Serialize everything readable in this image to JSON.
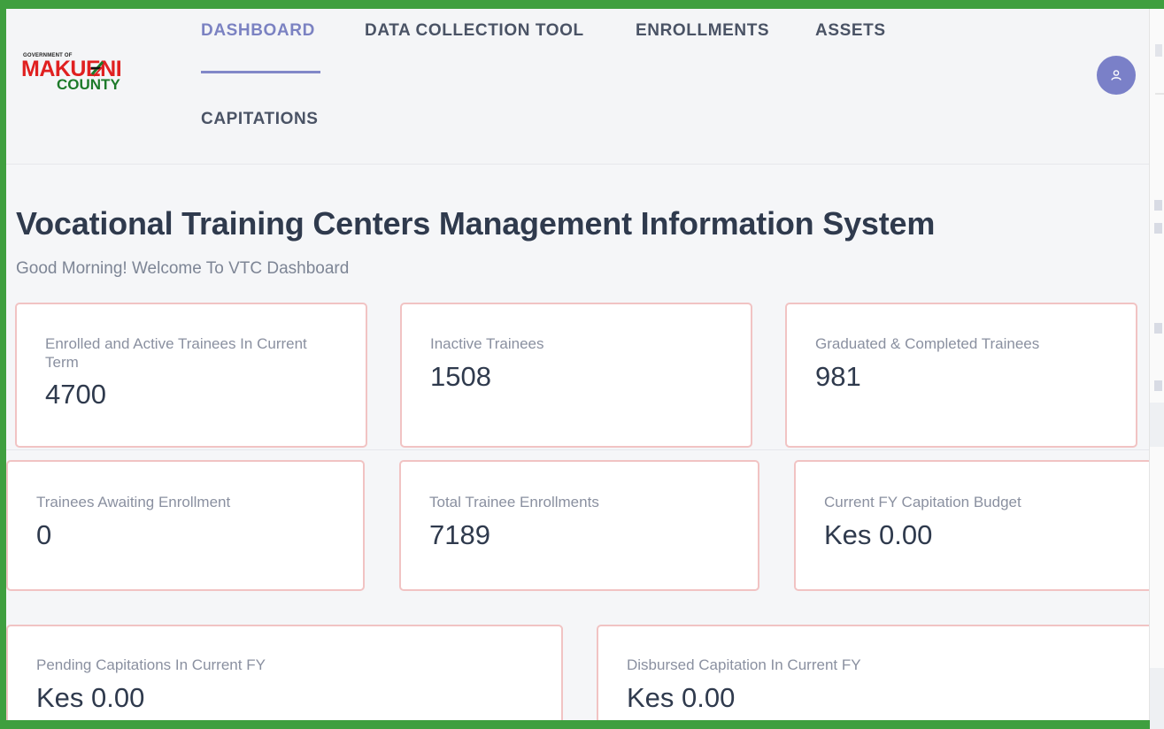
{
  "logo": {
    "top_text": "GOVERNMENT OF",
    "name": "MAKUENI",
    "sub": "COUNTY"
  },
  "nav": {
    "items": [
      {
        "label": "DASHBOARD",
        "active": true
      },
      {
        "label": "DATA COLLECTION TOOL",
        "active": false
      },
      {
        "label": "ENROLLMENTS",
        "active": false
      },
      {
        "label": "ASSETS",
        "active": false
      },
      {
        "label": "CAPITATIONS",
        "active": false
      }
    ]
  },
  "user": {
    "icon": "user-icon"
  },
  "page": {
    "title": "Vocational Training Centers Management Information System",
    "subtitle": "Good Morning! Welcome To VTC Dashboard"
  },
  "cards": [
    {
      "label": "Enrolled and Active Trainees In Current Term",
      "value": "4700"
    },
    {
      "label": "Inactive Trainees",
      "value": "1508"
    },
    {
      "label": "Graduated & Completed Trainees",
      "value": "981"
    },
    {
      "label": "Trainees Awaiting Enrollment",
      "value": "0"
    },
    {
      "label": "Total Trainee Enrollments",
      "value": "7189"
    },
    {
      "label": "Current FY Capitation Budget",
      "value": "Kes 0.00"
    },
    {
      "label": "Pending Capitations In Current FY",
      "value": "Kes 0.00"
    },
    {
      "label": "Disbursed Capitation In Current FY",
      "value": "Kes 0.00"
    }
  ],
  "colors": {
    "accent": "#7b82c2",
    "card_border": "#f1c3c3",
    "logo_red": "#e02020",
    "logo_green": "#1d7a2a",
    "frame_green": "#3f9f3f"
  }
}
